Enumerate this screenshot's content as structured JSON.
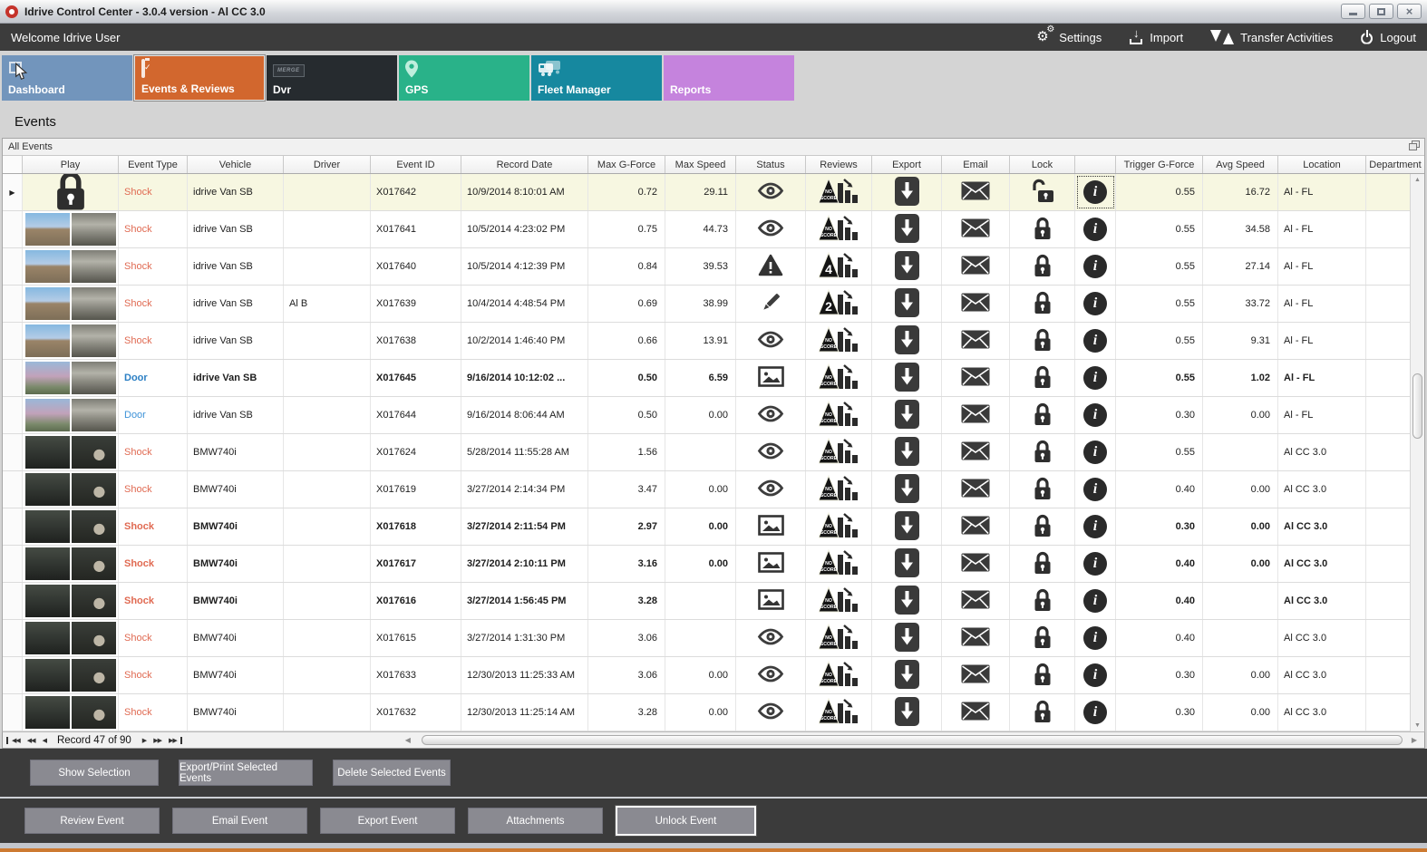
{
  "window": {
    "title": "Idrive Control Center - 3.0.4 version - Al CC 3.0",
    "controls": [
      "minimize",
      "maximize",
      "close"
    ]
  },
  "header": {
    "welcome": "Welcome Idrive User",
    "actions": [
      {
        "label": "Settings",
        "icon": "gears-icon"
      },
      {
        "label": "Import",
        "icon": "import-arrow-icon"
      },
      {
        "label": "Transfer Activities",
        "icon": "transfer-arrows-icon"
      },
      {
        "label": "Logout",
        "icon": "power-icon"
      }
    ]
  },
  "tabs": [
    {
      "label": "Dashboard",
      "color": "#7295bc",
      "icon": "dashboard-icon",
      "selected": false
    },
    {
      "label": "Events & Reviews",
      "color": "#d2672e",
      "icon": "clipboard-check-icon",
      "selected": true
    },
    {
      "label": "Dvr",
      "color": "#262b2f",
      "icon": "dvr-merge-icon",
      "icon_label": "MERGE",
      "selected": false
    },
    {
      "label": "GPS",
      "color": "#29b289",
      "icon": "location-pin-icon",
      "selected": false
    },
    {
      "label": "Fleet Manager",
      "color": "#16889f",
      "icon": "fleet-trucks-icon",
      "selected": false
    },
    {
      "label": "Reports",
      "color": "#c583dd",
      "icon": "pie-chart-icon",
      "selected": false
    }
  ],
  "page": {
    "title": "Events",
    "panel_title": "All Events"
  },
  "grid": {
    "columns": [
      "Play",
      "Event Type",
      "Vehicle",
      "Driver",
      "Event ID",
      "Record Date",
      "Max G-Force",
      "Max Speed",
      "Status",
      "Reviews",
      "Export",
      "Email",
      "Lock",
      "",
      "Trigger G-Force",
      "Avg Speed",
      "Location",
      "Department"
    ],
    "rows": [
      {
        "selected": true,
        "bold": false,
        "play": "lock-icon",
        "thumb": "",
        "event_type": "Shock",
        "vehicle": "idrive Van SB",
        "driver": "",
        "event_id": "X017642",
        "record_date": "10/9/2014 8:10:01 AM",
        "max_g_force": "0.72",
        "max_speed": "29.11",
        "status_icon": "eye-icon",
        "review_score": "NO SCORE",
        "export_icon": "download-icon",
        "email_icon": "envelope-icon",
        "lock_icon": "unlock-icon",
        "info_icon": "info-icon",
        "trigger_g_force": "0.55",
        "avg_speed": "16.72",
        "location": "Al - FL",
        "department": ""
      },
      {
        "selected": false,
        "bold": false,
        "play": "thumbnails",
        "thumb": "road",
        "event_type": "Shock",
        "vehicle": "idrive Van SB",
        "driver": "",
        "event_id": "X017641",
        "record_date": "10/5/2014 4:23:02 PM",
        "max_g_force": "0.75",
        "max_speed": "44.73",
        "status_icon": "eye-icon",
        "review_score": "NO SCORE",
        "export_icon": "download-icon",
        "email_icon": "envelope-icon",
        "lock_icon": "lock-icon",
        "info_icon": "info-icon",
        "trigger_g_force": "0.55",
        "avg_speed": "34.58",
        "location": "Al - FL",
        "department": ""
      },
      {
        "selected": false,
        "bold": false,
        "play": "thumbnails",
        "thumb": "road",
        "event_type": "Shock",
        "vehicle": "idrive Van SB",
        "driver": "",
        "event_id": "X017640",
        "record_date": "10/5/2014 4:12:39 PM",
        "max_g_force": "0.84",
        "max_speed": "39.53",
        "status_icon": "warning-icon",
        "review_score": "4",
        "export_icon": "download-icon",
        "email_icon": "envelope-icon",
        "lock_icon": "lock-icon",
        "info_icon": "info-icon",
        "trigger_g_force": "0.55",
        "avg_speed": "27.14",
        "location": "Al - FL",
        "department": ""
      },
      {
        "selected": false,
        "bold": false,
        "play": "thumbnails",
        "thumb": "road",
        "event_type": "Shock",
        "vehicle": "idrive Van SB",
        "driver": "Al B",
        "event_id": "X017639",
        "record_date": "10/4/2014 4:48:54 PM",
        "max_g_force": "0.69",
        "max_speed": "38.99",
        "status_icon": "pencil-icon",
        "review_score": "2",
        "export_icon": "download-icon",
        "email_icon": "envelope-icon",
        "lock_icon": "lock-icon",
        "info_icon": "info-icon",
        "trigger_g_force": "0.55",
        "avg_speed": "33.72",
        "location": "Al - FL",
        "department": ""
      },
      {
        "selected": false,
        "bold": false,
        "play": "thumbnails",
        "thumb": "road",
        "event_type": "Shock",
        "vehicle": "idrive Van SB",
        "driver": "",
        "event_id": "X017638",
        "record_date": "10/2/2014 1:46:40 PM",
        "max_g_force": "0.66",
        "max_speed": "13.91",
        "status_icon": "eye-icon",
        "review_score": "NO SCORE",
        "export_icon": "download-icon",
        "email_icon": "envelope-icon",
        "lock_icon": "lock-icon",
        "info_icon": "info-icon",
        "trigger_g_force": "0.55",
        "avg_speed": "9.31",
        "location": "Al - FL",
        "department": ""
      },
      {
        "selected": false,
        "bold": true,
        "play": "thumbnails",
        "thumb": "blossom",
        "event_type": "Door",
        "vehicle": "idrive Van SB",
        "driver": "",
        "event_id": "X017645",
        "record_date": "9/16/2014 10:12:02 ...",
        "max_g_force": "0.50",
        "max_speed": "6.59",
        "status_icon": "picture-icon",
        "review_score": "NO SCORE",
        "export_icon": "download-icon",
        "email_icon": "envelope-icon",
        "lock_icon": "lock-icon",
        "info_icon": "info-icon",
        "trigger_g_force": "0.55",
        "avg_speed": "1.02",
        "location": "Al - FL",
        "department": ""
      },
      {
        "selected": false,
        "bold": false,
        "play": "thumbnails",
        "thumb": "blossom",
        "event_type": "Door",
        "vehicle": "idrive Van SB",
        "driver": "",
        "event_id": "X017644",
        "record_date": "9/16/2014 8:06:44 AM",
        "max_g_force": "0.50",
        "max_speed": "0.00",
        "status_icon": "eye-icon",
        "review_score": "NO SCORE",
        "export_icon": "download-icon",
        "email_icon": "envelope-icon",
        "lock_icon": "lock-icon",
        "info_icon": "info-icon",
        "trigger_g_force": "0.30",
        "avg_speed": "0.00",
        "location": "Al - FL",
        "department": ""
      },
      {
        "selected": false,
        "bold": false,
        "play": "thumbnails",
        "thumb": "dark",
        "event_type": "Shock",
        "vehicle": "BMW740i",
        "driver": "",
        "event_id": "X017624",
        "record_date": "5/28/2014 11:55:28 AM",
        "max_g_force": "1.56",
        "max_speed": "",
        "status_icon": "eye-icon",
        "review_score": "NO SCORE",
        "export_icon": "download-icon",
        "email_icon": "envelope-icon",
        "lock_icon": "lock-icon",
        "info_icon": "info-icon",
        "trigger_g_force": "0.55",
        "avg_speed": "",
        "location": "Al CC 3.0",
        "department": ""
      },
      {
        "selected": false,
        "bold": false,
        "play": "thumbnails",
        "thumb": "dark",
        "event_type": "Shock",
        "vehicle": "BMW740i",
        "driver": "",
        "event_id": "X017619",
        "record_date": "3/27/2014 2:14:34 PM",
        "max_g_force": "3.47",
        "max_speed": "0.00",
        "status_icon": "eye-icon",
        "review_score": "NO SCORE",
        "export_icon": "download-icon",
        "email_icon": "envelope-icon",
        "lock_icon": "lock-icon",
        "info_icon": "info-icon",
        "trigger_g_force": "0.40",
        "avg_speed": "0.00",
        "location": "Al CC 3.0",
        "department": ""
      },
      {
        "selected": false,
        "bold": true,
        "play": "thumbnails",
        "thumb": "dark",
        "event_type": "Shock",
        "vehicle": "BMW740i",
        "driver": "",
        "event_id": "X017618",
        "record_date": "3/27/2014 2:11:54 PM",
        "max_g_force": "2.97",
        "max_speed": "0.00",
        "status_icon": "picture-icon",
        "review_score": "NO SCORE",
        "export_icon": "download-icon",
        "email_icon": "envelope-icon",
        "lock_icon": "lock-icon",
        "info_icon": "info-icon",
        "trigger_g_force": "0.30",
        "avg_speed": "0.00",
        "location": "Al CC 3.0",
        "department": ""
      },
      {
        "selected": false,
        "bold": true,
        "play": "thumbnails",
        "thumb": "dark",
        "event_type": "Shock",
        "vehicle": "BMW740i",
        "driver": "",
        "event_id": "X017617",
        "record_date": "3/27/2014 2:10:11 PM",
        "max_g_force": "3.16",
        "max_speed": "0.00",
        "status_icon": "picture-icon",
        "review_score": "NO SCORE",
        "export_icon": "download-icon",
        "email_icon": "envelope-icon",
        "lock_icon": "lock-icon",
        "info_icon": "info-icon",
        "trigger_g_force": "0.40",
        "avg_speed": "0.00",
        "location": "Al CC 3.0",
        "department": ""
      },
      {
        "selected": false,
        "bold": true,
        "play": "thumbnails",
        "thumb": "dark",
        "event_type": "Shock",
        "vehicle": "BMW740i",
        "driver": "",
        "event_id": "X017616",
        "record_date": "3/27/2014 1:56:45 PM",
        "max_g_force": "3.28",
        "max_speed": "",
        "status_icon": "picture-icon",
        "review_score": "NO SCORE",
        "export_icon": "download-icon",
        "email_icon": "envelope-icon",
        "lock_icon": "lock-icon",
        "info_icon": "info-icon",
        "trigger_g_force": "0.40",
        "avg_speed": "",
        "location": "Al CC 3.0",
        "department": ""
      },
      {
        "selected": false,
        "bold": false,
        "play": "thumbnails",
        "thumb": "dark",
        "event_type": "Shock",
        "vehicle": "BMW740i",
        "driver": "",
        "event_id": "X017615",
        "record_date": "3/27/2014 1:31:30 PM",
        "max_g_force": "3.06",
        "max_speed": "",
        "status_icon": "eye-icon",
        "review_score": "NO SCORE",
        "export_icon": "download-icon",
        "email_icon": "envelope-icon",
        "lock_icon": "lock-icon",
        "info_icon": "info-icon",
        "trigger_g_force": "0.40",
        "avg_speed": "",
        "location": "Al CC 3.0",
        "department": ""
      },
      {
        "selected": false,
        "bold": false,
        "play": "thumbnails",
        "thumb": "dark",
        "event_type": "Shock",
        "vehicle": "BMW740i",
        "driver": "",
        "event_id": "X017633",
        "record_date": "12/30/2013 11:25:33 AM",
        "max_g_force": "3.06",
        "max_speed": "0.00",
        "status_icon": "eye-icon",
        "review_score": "NO SCORE",
        "export_icon": "download-icon",
        "email_icon": "envelope-icon",
        "lock_icon": "lock-icon",
        "info_icon": "info-icon",
        "trigger_g_force": "0.30",
        "avg_speed": "0.00",
        "location": "Al CC 3.0",
        "department": ""
      },
      {
        "selected": false,
        "bold": false,
        "play": "thumbnails",
        "thumb": "dark",
        "event_type": "Shock",
        "vehicle": "BMW740i",
        "driver": "",
        "event_id": "X017632",
        "record_date": "12/30/2013 11:25:14 AM",
        "max_g_force": "3.28",
        "max_speed": "0.00",
        "status_icon": "eye-icon",
        "review_score": "NO SCORE",
        "export_icon": "download-icon",
        "email_icon": "envelope-icon",
        "lock_icon": "lock-icon",
        "info_icon": "info-icon",
        "trigger_g_force": "0.30",
        "avg_speed": "0.00",
        "location": "Al CC 3.0",
        "department": ""
      }
    ],
    "record_status": "Record 47 of 90"
  },
  "toolbar1": {
    "buttons": [
      "Show Selection",
      "Export/Print Selected Events",
      "Delete Selected Events"
    ]
  },
  "toolbar2": {
    "buttons": [
      "Review Event",
      "Email Event",
      "Export Event",
      "Attachments",
      "Unlock Event"
    ],
    "focused": "Unlock Event"
  },
  "colors": {
    "selected_tab": "#d2672e",
    "shock_text": "#e06a52",
    "door_text": "#3e93d8",
    "selected_row": "#f7f7e1",
    "bottom_accent": "#cd7a31"
  }
}
